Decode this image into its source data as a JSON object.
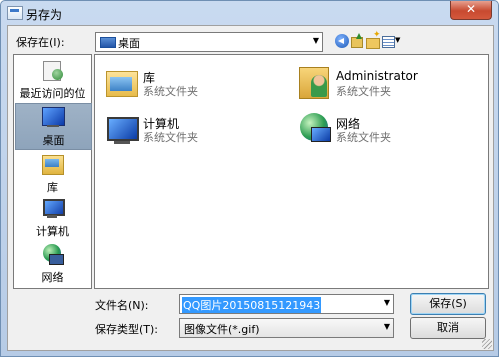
{
  "window": {
    "title": "另存为",
    "close_glyph": "✕"
  },
  "toolbar": {
    "look_in_label": "保存在(I):",
    "look_in_value": "桌面"
  },
  "places": [
    {
      "label": "最近访问的位置",
      "icon": "recent-places-icon"
    },
    {
      "label": "桌面",
      "icon": "desktop-icon",
      "selected": true
    },
    {
      "label": "库",
      "icon": "libraries-icon"
    },
    {
      "label": "计算机",
      "icon": "computer-icon"
    },
    {
      "label": "网络",
      "icon": "network-icon"
    }
  ],
  "files": [
    {
      "name": "库",
      "type": "系统文件夹",
      "icon": "libraries-folder-icon"
    },
    {
      "name": "Administrator",
      "type": "系统文件夹",
      "icon": "user-folder-icon"
    },
    {
      "name": "计算机",
      "type": "系统文件夹",
      "icon": "computer-icon"
    },
    {
      "name": "网络",
      "type": "系统文件夹",
      "icon": "network-icon"
    }
  ],
  "form": {
    "filename_label": "文件名(N):",
    "filename_value": "QQ图片20150815121943",
    "filetype_label": "保存类型(T):",
    "filetype_value": "图像文件(*.gif)"
  },
  "buttons": {
    "save": "保存(S)",
    "cancel": "取消"
  },
  "colors": {
    "selection": "#3399ff",
    "titlebar": "#c9daf0",
    "close": "#c84a30"
  }
}
